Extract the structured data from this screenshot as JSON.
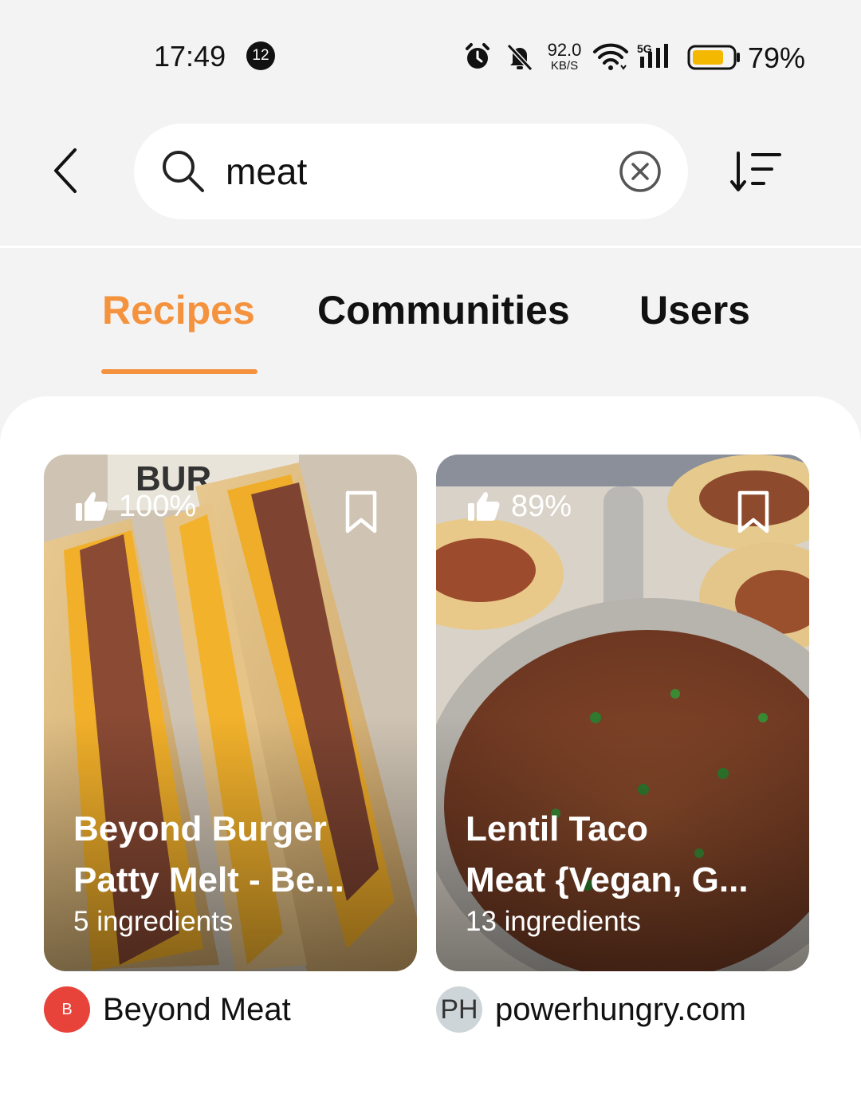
{
  "status_bar": {
    "time": "17:49",
    "notification_count": "12",
    "net_speed_value": "92.0",
    "net_speed_unit": "KB/S",
    "network": "5G",
    "battery_percent": "79%",
    "battery_level": 0.79
  },
  "search": {
    "query": "meat",
    "placeholder": ""
  },
  "tabs": [
    {
      "label": "Recipes",
      "active": true
    },
    {
      "label": "Communities",
      "active": false
    },
    {
      "label": "Users",
      "active": false
    }
  ],
  "colors": {
    "accent": "#f5923e",
    "beyond_avatar": "#e8433a",
    "ph_avatar": "#cdd5d9"
  },
  "results": [
    {
      "rating": "100%",
      "title_line1": "Beyond Burger",
      "title_line2": "Patty Melt - Be...",
      "ingredients": "5 ingredients",
      "source_initials": "B",
      "source_name": "Beyond Meat"
    },
    {
      "rating": "89%",
      "title_line1": "Lentil Taco",
      "title_line2": "Meat {Vegan, G...",
      "ingredients": "13 ingredients",
      "source_initials": "PH",
      "source_name": "powerhungry.com"
    }
  ]
}
